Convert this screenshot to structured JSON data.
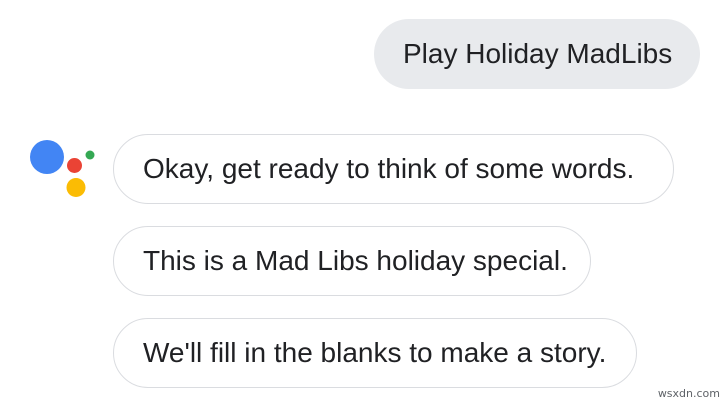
{
  "conversation": {
    "user_message": "Play Holiday MadLibs",
    "assistant_messages": [
      {
        "text": "Okay, get ready to think of some words."
      },
      {
        "text": "This is a Mad Libs holiday special."
      },
      {
        "text": "We'll fill in the blanks to make a story."
      }
    ]
  },
  "assistant_logo": {
    "icon": "google-assistant-icon",
    "colors": {
      "blue": "#4285f4",
      "red": "#ea4335",
      "yellow": "#fbbc04",
      "green": "#34a853"
    }
  },
  "watermark": "wsxdn.com"
}
